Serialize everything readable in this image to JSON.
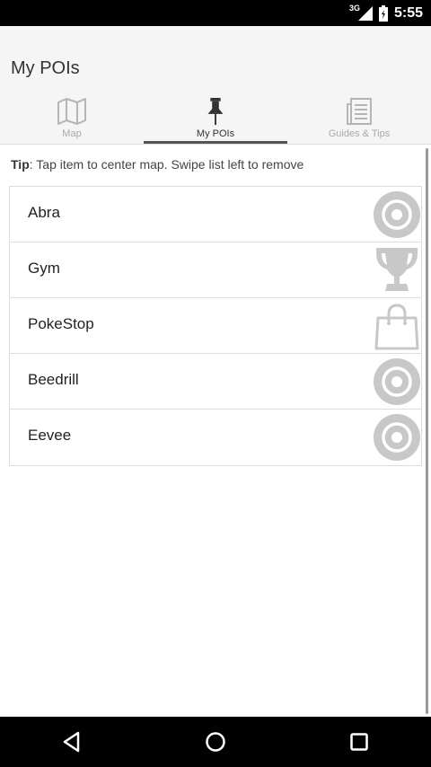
{
  "status_bar": {
    "network": "3G",
    "time": "5:55"
  },
  "app": {
    "title": "My POIs"
  },
  "tabs": [
    {
      "label": "Map",
      "icon": "map-icon",
      "active": false
    },
    {
      "label": "My POIs",
      "icon": "pin-icon",
      "active": true
    },
    {
      "label": "Guides & Tips",
      "icon": "document-icon",
      "active": false
    }
  ],
  "tip": {
    "prefix": "Tip",
    "text": ": Tap item to center map. Swipe list left to remove"
  },
  "pois": [
    {
      "name": "Abra",
      "icon": "target-icon"
    },
    {
      "name": "Gym",
      "icon": "trophy-icon"
    },
    {
      "name": "PokeStop",
      "icon": "shopping-bag-icon"
    },
    {
      "name": "Beedrill",
      "icon": "target-icon"
    },
    {
      "name": "Eevee",
      "icon": "target-icon"
    }
  ],
  "colors": {
    "icon_gray": "#c8c8c8",
    "active_tab": "#333333",
    "inactive_tab": "#aaaaaa"
  }
}
